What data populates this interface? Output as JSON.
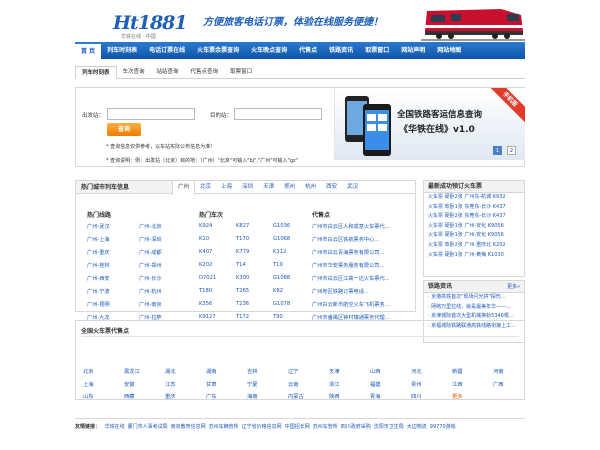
{
  "header": {
    "logo_text": "Ht1881",
    "logo_sub": "华铁在线 · 中国",
    "slogan": "方便旅客电话订票，体验在线服务便捷！"
  },
  "nav": [
    "首 页",
    "列车时刻表",
    "电话订票在线",
    "火车票余票查询",
    "火车晚点查询",
    "代售点",
    "铁路资讯",
    "取票窗口",
    "网站声明",
    "网站地图"
  ],
  "subnav": [
    "列车时刻表",
    "车次查询",
    "站站查询",
    "代售点查询",
    "取票窗口"
  ],
  "search": {
    "from_label": "出发站：",
    "to_label": "目的站：",
    "button": "查询",
    "note1": "* 查询信息仅供参考，以车站实际公布信息为准!",
    "note2": "* 查询说明：例：出发站（北京）目的地：（广州）\"北京\"可输入\"bj\",\"广州\"可输入\"gz\""
  },
  "banner": {
    "title": "全国铁路客运信息查询",
    "subtitle": "《华铁在线》v1.0",
    "ribbon": "手机版",
    "pages": [
      "1",
      "2"
    ]
  },
  "hot": {
    "title": "热门城市列车信息",
    "tabs": [
      "广州",
      "北京",
      "上海",
      "深圳",
      "天津",
      "郑州",
      "杭州",
      "西安",
      "武汉"
    ],
    "lines_title": "热门线路",
    "lines": [
      "广州-武汉",
      "广州-北京",
      "广州-上海",
      "广州-深圳",
      "广州-重庆",
      "广州-成都",
      "广州-桂林",
      "广州-郑州",
      "广州-西安",
      "广州-长沙",
      "广州-宁波",
      "广州-杭州",
      "广州-昆明",
      "广州-南京",
      "广州-九龙",
      "广州-拉萨"
    ],
    "trains_title": "热门车次",
    "trains": [
      "K924",
      "K827",
      "G1036",
      "K10",
      "T170",
      "G1068",
      "K407",
      "K779",
      "K312",
      "K202",
      "T14",
      "T19",
      "D7021",
      "K300",
      "G1088",
      "T180",
      "T265",
      "K82",
      "K356",
      "T236",
      "G1078",
      "K9127",
      "T172",
      "T90"
    ],
    "agents_title": "代售点",
    "agents": [
      "广州市白云区人和成意火车票代...",
      "广州市白云区铁航票务中心...",
      "广州市白云青海票务有限公司...",
      "广州市华安票务服务有限公司...",
      "广州市白云区江高一达火车票代...",
      "广州地区铁路订票电话...",
      "广州白云新市航空火车飞机票务...",
      "广州市番禺区钟村镇通票务代理..."
    ]
  },
  "side1": {
    "title": "最新成功预订火车票",
    "rows": [
      "火车票 硬卧2张 广州东-杭城 K932",
      "火车票 软卧1张 东莞东-长沙 K437",
      "火车票 硬卧2张 东莞东-长沙 K437",
      "火车票 硬卧1张 广州-安化 K9056",
      "火车票 硬卧1张 广州-安化 K9056",
      "火车票 软卧2张 广州-重庆北 K202",
      "火车票 硬卧1张 广州-黄梅 K1030"
    ]
  },
  "side2": {
    "title": "铁路资讯",
    "more": "更多»",
    "rows": [
      "· 京港高铁首次\"现场闪光拼\"探伤...",
      "· 网络万里拉线，就是最美年华——...",
      "· 京津城际首次大型机械换轨5346根...",
      "· 京福城际铁路联通高铁线路衔接上工..."
    ]
  },
  "agents_section": {
    "title": "全国火车票代售点",
    "provinces": [
      "北京",
      "黑龙江",
      "湖北",
      "湖南",
      "吉林",
      "辽宁",
      "天津",
      "山西",
      "河北",
      "新疆",
      "河南",
      "上海",
      "安徽",
      "江苏",
      "甘肃",
      "宁夏",
      "云南",
      "浙江",
      "福建",
      "贵州",
      "江西",
      "广西",
      "山东",
      "西藏",
      "重庆",
      "广东",
      "海南",
      "内蒙古",
      "陕西",
      "青海",
      "四川",
      "更多"
    ]
  },
  "footer": {
    "label": "友情链接：",
    "links": [
      "华铁在线",
      "厦门市人事考试局",
      "南京教育信息网",
      "苏州车辆管所",
      "辽宁省价格信息网",
      "中国招长网",
      "苏州车管所",
      "四川政府采购",
      "沈阳市卫生局",
      "大边物流",
      "99770游戏"
    ]
  },
  "colors": {
    "primary": "#1b58b8",
    "nav": "#1a66c0",
    "button": "#f59014"
  }
}
